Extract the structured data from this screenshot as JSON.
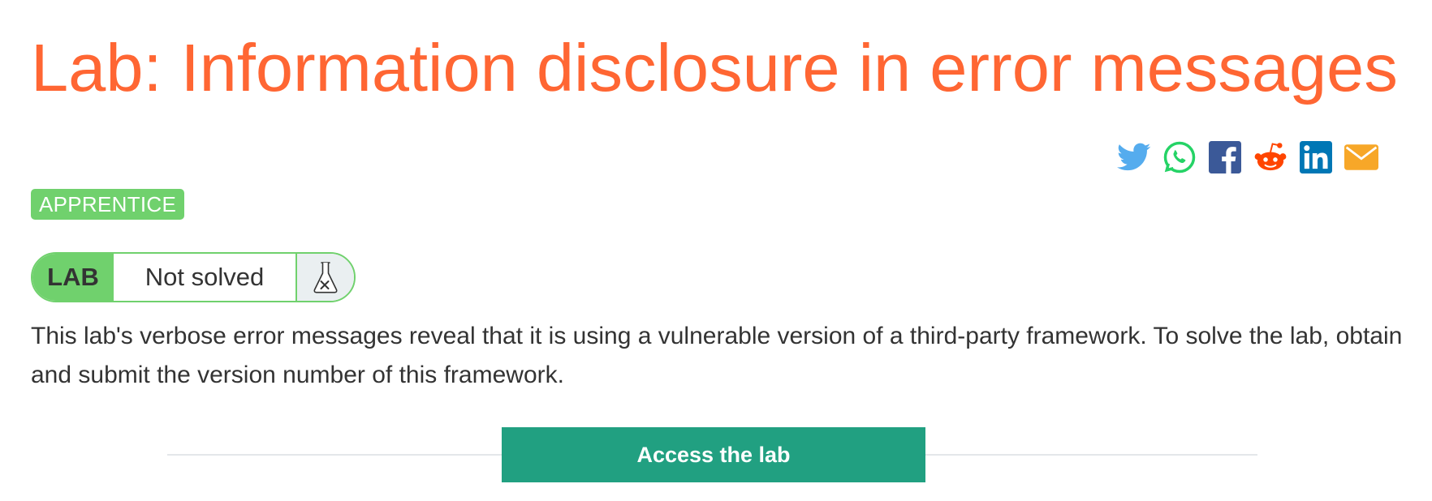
{
  "header": {
    "title": "Lab: Information disclosure in error messages"
  },
  "share": {
    "icons": [
      "twitter-icon",
      "whatsapp-icon",
      "facebook-icon",
      "reddit-icon",
      "linkedin-icon",
      "email-icon"
    ],
    "colors": {
      "twitter": "#55acee",
      "whatsapp": "#25d366",
      "facebook": "#3b5998",
      "reddit": "#ff4500",
      "linkedin": "#0077b5",
      "email": "#f7a728"
    }
  },
  "level": {
    "label": "APPRENTICE",
    "color": "#70d16d"
  },
  "status": {
    "lab_label": "LAB",
    "state": "Not solved",
    "icon": "flask-icon"
  },
  "description": "This lab's verbose error messages reveal that it is using a vulnerable version of a third-party framework. To solve the lab, obtain and submit the version number of this framework.",
  "access": {
    "label": "Access the lab",
    "color": "#21a081"
  },
  "theme": {
    "title_color": "#ff6633",
    "text_color": "#333333"
  }
}
